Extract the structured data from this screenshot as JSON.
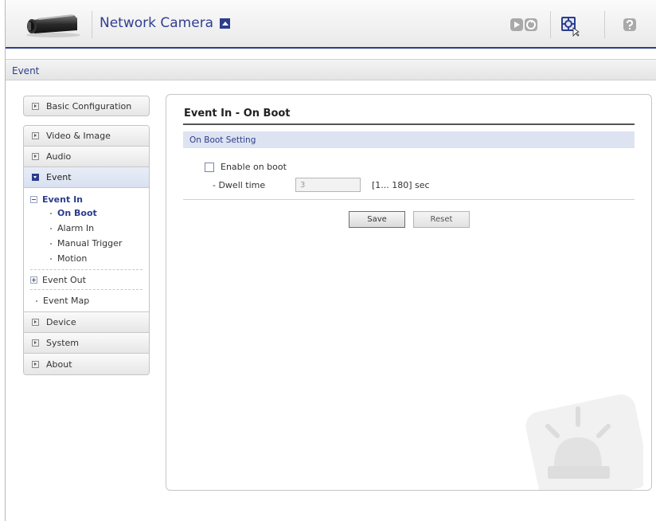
{
  "header": {
    "title": "Network Camera",
    "icons": [
      "camera-logo",
      "title-dropdown-icon",
      "live-view-icon",
      "setup-icon",
      "help-icon"
    ]
  },
  "breadcrumb": "Event",
  "sidebar": {
    "basic_configuration": "Basic Configuration",
    "video_image": "Video & Image",
    "audio": "Audio",
    "event": "Event",
    "event_in": "Event In",
    "event_in_items": [
      "On Boot",
      "Alarm In",
      "Manual Trigger",
      "Motion"
    ],
    "event_out": "Event Out",
    "event_map": "Event Map",
    "device": "Device",
    "system": "System",
    "about": "About"
  },
  "main": {
    "title": "Event In - On Boot",
    "section": "On Boot Setting",
    "enable_label": "Enable on boot",
    "enable_checked": false,
    "dwell_label": "- Dwell time",
    "dwell_value": "3",
    "dwell_range": "[1... 180] sec",
    "save_label": "Save",
    "reset_label": "Reset"
  },
  "colors": {
    "brand": "#2c3d8c",
    "section_bar": "#dde3f1"
  }
}
